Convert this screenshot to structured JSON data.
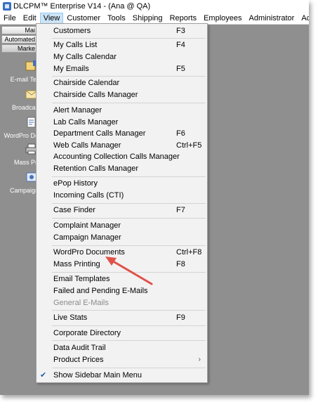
{
  "window": {
    "title": "DLCPM™ Enterprise V14 - (Ana @ QA)",
    "partial_label": "H"
  },
  "menubar": [
    "File",
    "Edit",
    "View",
    "Customer",
    "Tools",
    "Shipping",
    "Reports",
    "Employees",
    "Administrator",
    "Accounting"
  ],
  "sidebar": {
    "tabs": [
      "Mai",
      "Automated",
      "Marke"
    ],
    "entries": [
      "E-mail Ter",
      "Broadcas",
      "WordPro Do",
      "Mass Pri",
      "Campaign"
    ]
  },
  "view_menu": [
    {
      "label": "Customers",
      "shortcut": "F3"
    },
    {
      "label": "My Calls List",
      "shortcut": "F4"
    },
    {
      "label": "My Calls Calendar",
      "shortcut": ""
    },
    {
      "label": "My Emails",
      "shortcut": "F5"
    },
    {
      "label": "Chairside Calendar",
      "shortcut": ""
    },
    {
      "label": "Chairside Calls Manager",
      "shortcut": ""
    },
    {
      "label": "Alert Manager",
      "shortcut": ""
    },
    {
      "label": "Lab Calls Manager",
      "shortcut": ""
    },
    {
      "label": "Department Calls Manager",
      "shortcut": "F6"
    },
    {
      "label": "Web Calls Manager",
      "shortcut": "Ctrl+F5"
    },
    {
      "label": "Accounting Collection Calls Manager",
      "shortcut": ""
    },
    {
      "label": "Retention Calls Manager",
      "shortcut": ""
    },
    {
      "label": "ePop History",
      "shortcut": ""
    },
    {
      "label": "Incoming Calls (CTI)",
      "shortcut": ""
    },
    {
      "label": "Case Finder",
      "shortcut": "F7"
    },
    {
      "label": "Complaint Manager",
      "shortcut": ""
    },
    {
      "label": "Campaign Manager",
      "shortcut": ""
    },
    {
      "label": "WordPro Documents",
      "shortcut": "Ctrl+F8"
    },
    {
      "label": "Mass Printing",
      "shortcut": "F8"
    },
    {
      "label": "Email Templates",
      "shortcut": ""
    },
    {
      "label": "Failed and Pending E-Mails",
      "shortcut": ""
    },
    {
      "label": "General E-Mails",
      "shortcut": "",
      "disabled": true
    },
    {
      "label": "Live Stats",
      "shortcut": "F9"
    },
    {
      "label": "Corporate Directory",
      "shortcut": ""
    },
    {
      "label": "Data Audit Trail",
      "shortcut": ""
    },
    {
      "label": "Product Prices",
      "shortcut": "",
      "submenu": true
    },
    {
      "label": "Show Sidebar Main Menu",
      "shortcut": "",
      "checked": true
    }
  ],
  "colors": {
    "menu_highlight": "#cce4f7",
    "arrow": "#e0524a",
    "check": "#1e5fb0"
  }
}
